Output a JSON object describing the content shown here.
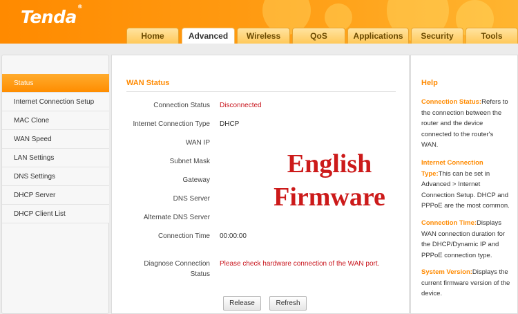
{
  "brand": {
    "name": "Tenda",
    "mark": "®"
  },
  "tabs": [
    {
      "label": "Home",
      "active": false
    },
    {
      "label": "Advanced",
      "active": true
    },
    {
      "label": "Wireless",
      "active": false
    },
    {
      "label": "QoS",
      "active": false
    },
    {
      "label": "Applications",
      "active": false
    },
    {
      "label": "Security",
      "active": false
    },
    {
      "label": "Tools",
      "active": false
    }
  ],
  "sidebar": {
    "items": [
      {
        "label": "Status",
        "active": true
      },
      {
        "label": "Internet Connection Setup"
      },
      {
        "label": "MAC Clone"
      },
      {
        "label": "WAN Speed"
      },
      {
        "label": "LAN Settings"
      },
      {
        "label": "DNS Settings"
      },
      {
        "label": "DHCP Server"
      },
      {
        "label": "DHCP Client List"
      }
    ]
  },
  "main": {
    "title": "WAN Status",
    "rows": [
      {
        "label": "Connection Status",
        "value": "Disconnected"
      },
      {
        "label": "Internet Connection Type",
        "value": "DHCP"
      },
      {
        "label": "WAN IP",
        "value": ""
      },
      {
        "label": "Subnet Mask",
        "value": ""
      },
      {
        "label": "Gateway",
        "value": ""
      },
      {
        "label": "DNS Server",
        "value": ""
      },
      {
        "label": "Alternate DNS Server",
        "value": ""
      },
      {
        "label": "Connection Time",
        "value": "00:00:00"
      }
    ],
    "diagnose": {
      "label_line1": "Diagnose Connection",
      "label_line2": "Status",
      "value": "Please check hardware connection of the WAN port."
    },
    "buttons": {
      "release": "Release",
      "refresh": "Refresh"
    },
    "watermark": {
      "line1": "English",
      "line2": "Firmware"
    }
  },
  "help": {
    "title": "Help",
    "sections": [
      {
        "key": "Connection Status:",
        "text": "Refers to the connection between the router and the device connected to the router's WAN."
      },
      {
        "key": "Internet Connection Type:",
        "text": "This can be set in Advanced > Internet Connection Setup. DHCP and PPPoE are the most common."
      },
      {
        "key": "Connection Time:",
        "text": "Displays WAN connection duration for the DHCP/Dynamic IP and PPPoE connection type."
      },
      {
        "key": "System Version:",
        "text": "Displays the current firmware version of the device."
      }
    ]
  },
  "colors": {
    "accent": "#ff8a00",
    "alert": "#c8151d",
    "watermark": "#cc1a1a"
  }
}
